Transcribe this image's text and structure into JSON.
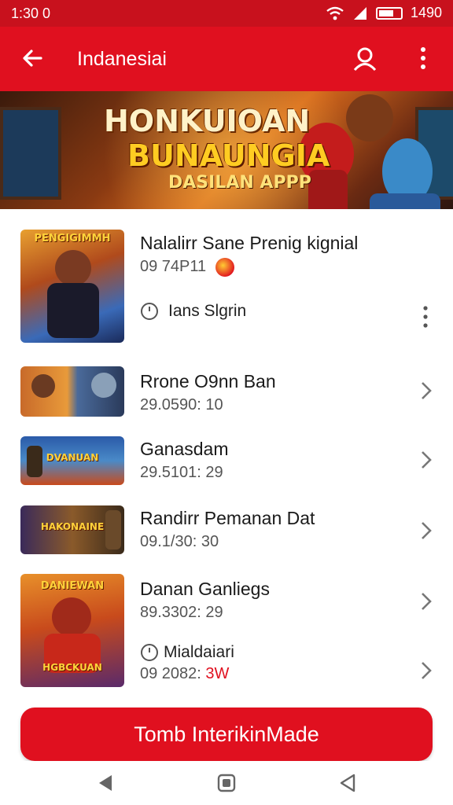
{
  "status_bar": {
    "time": "1:30 0",
    "battery_text": "1490"
  },
  "app_bar": {
    "title": "Indanesiai"
  },
  "banner": {
    "line1": "HONKUIOAN",
    "line2": "BUNAUNGIA",
    "line3": "DASILAN APPP"
  },
  "items": [
    {
      "thumb_caption": "PENGIGIMMH",
      "title": "Nalalirr Sane Prenig kignial",
      "subtitle": "09 74P11",
      "meta": "Ians Slgrin"
    },
    {
      "thumb_caption": "",
      "title": "Rrone O9nn Ban",
      "subtitle": "29.0590: 10"
    },
    {
      "thumb_caption": "DVANUAN",
      "title": "Ganasdam",
      "subtitle": "29.5101: 29"
    },
    {
      "thumb_caption": "HAKONAINE",
      "title": "Randirr Pemanan Dat",
      "subtitle": "09.1/30: 30"
    },
    {
      "thumb_caption": "DANIEWAN",
      "thumb_caption2": "HGBCKUAN",
      "title": "Danan Ganliegs",
      "subtitle": "89.3302: 29",
      "meta": "Mialdaiari",
      "subtitle2_prefix": "09 2082:",
      "subtitle2_highlight": "3W"
    }
  ],
  "cta": {
    "label": "Tomb InterikinMade"
  },
  "colors": {
    "primary": "#e0101f",
    "status_bar": "#c8111d"
  },
  "icons": [
    "back-arrow-icon",
    "account-icon",
    "more-vert-icon",
    "clock-icon",
    "chevron-right-icon",
    "nav-back-icon",
    "nav-home-icon",
    "nav-recents-icon",
    "wifi-icon",
    "signal-icon",
    "battery-icon"
  ]
}
